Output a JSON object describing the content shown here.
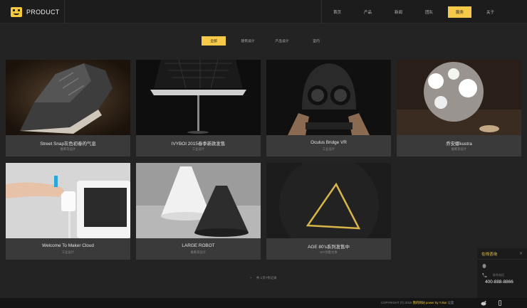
{
  "header": {
    "logo_text": "PRODUCT",
    "nav": [
      "首页",
      "产品",
      "新闻",
      "团队",
      "服务",
      "关于"
    ],
    "active_nav": "服务"
  },
  "filters": {
    "items": [
      "全部",
      "建筑设计",
      "产品设计",
      "室内"
    ],
    "active": "全部"
  },
  "cards": [
    {
      "title": "Street Snap灰色初春的气息",
      "category": "推断及设计"
    },
    {
      "title": "IVYBOI 2015春季新款发售",
      "category": "工业设计"
    },
    {
      "title": "Oculus Bridge VR",
      "category": "工业设计"
    },
    {
      "title": "乔安娜kustra",
      "category": "推断及设计"
    },
    {
      "title": "Welcome To Maker Cloud",
      "category": "工业设计"
    },
    {
      "title": "LARGE ROBOT",
      "category": "推断及设计"
    },
    {
      "title": "AGE 80's系列发售中",
      "category": "DIY创意文本"
    }
  ],
  "pagination": {
    "text": "共 1页7条记录"
  },
  "footer": {
    "copyright": "COPYRIGHT (©) 2016",
    "site": "我的网站",
    "powered": "power by YJlun",
    "extra": "设置"
  },
  "consult": {
    "title": "在线咨询",
    "close": "✕",
    "placeholder": "",
    "hotline_label": "联系电话",
    "phone": "400-888-8866"
  },
  "colors": {
    "accent": "#f7c948",
    "background": "#232323"
  }
}
